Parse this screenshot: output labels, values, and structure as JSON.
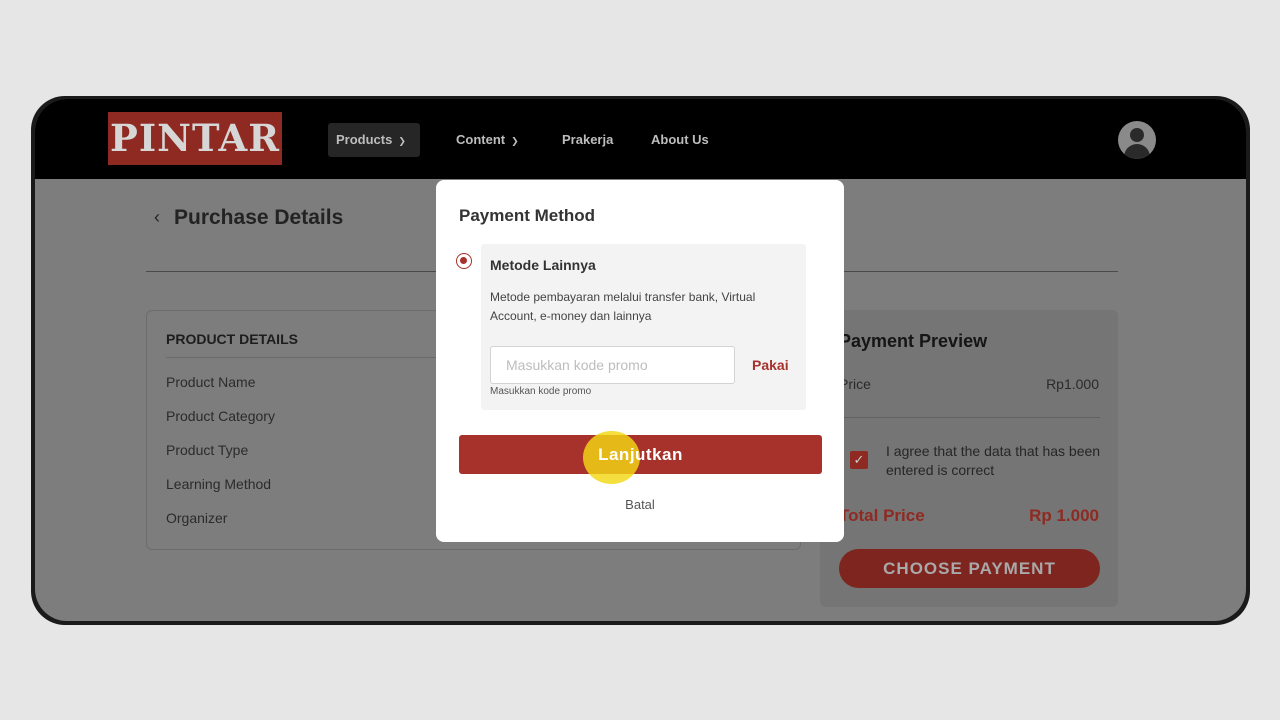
{
  "navbar": {
    "logo": "PINTAR",
    "items": [
      {
        "label": "Products",
        "dropdown": true,
        "active": true
      },
      {
        "label": "Content",
        "dropdown": true
      },
      {
        "label": "Prakerja"
      },
      {
        "label": "About Us"
      }
    ],
    "avatar_icon": "user-avatar-icon"
  },
  "page": {
    "back_icon": "‹",
    "title": "Purchase Details",
    "product_details": {
      "heading": "PRODUCT DETAILS",
      "rows": [
        "Product Name",
        "Product Category",
        "Product Type",
        "Learning Method",
        "Organizer"
      ]
    },
    "payment_preview": {
      "heading": "Payment Preview",
      "price_label": "Price",
      "price_value": "Rp1.000",
      "agree_checked": true,
      "agree_text": "I agree that the data that has been entered is correct",
      "total_label": "Total Price",
      "total_value": "Rp 1.000",
      "choose_button": "CHOOSE PAYMENT"
    }
  },
  "modal": {
    "title": "Payment Method",
    "option": {
      "selected": true,
      "title": "Metode Lainnya",
      "description": "Metode pembayaran melalui transfer bank, Virtual Account, e-money dan lainnya",
      "promo_placeholder": "Masukkan kode promo",
      "promo_value": "",
      "apply_label": "Pakai",
      "promo_help": "Masukkan kode promo"
    },
    "continue_button": "Lanjutkan",
    "cancel_link": "Batal"
  },
  "colors": {
    "brand_red": "#a7312b",
    "navbar_bg": "#000000",
    "overlay_bg": "#7d7d7d",
    "cursor_highlight": "#f3d814"
  }
}
